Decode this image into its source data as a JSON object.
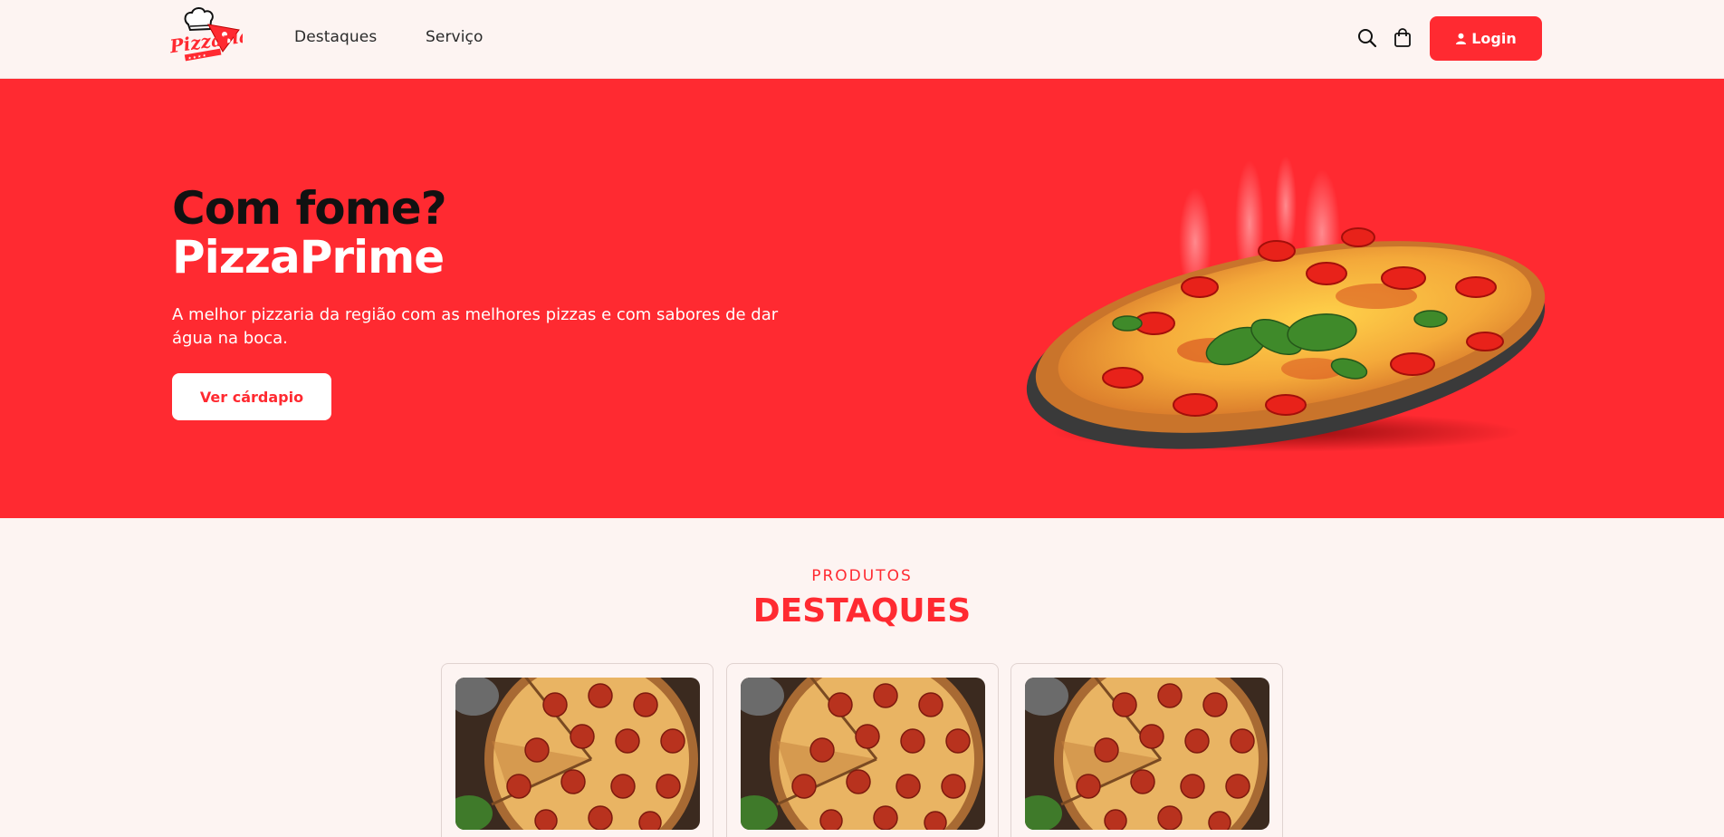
{
  "navbar": {
    "logo_alt": "Pizzaria logo",
    "links": [
      {
        "label": "Destaques"
      },
      {
        "label": "Serviço"
      }
    ],
    "search_icon": "search-icon",
    "cart_icon": "shopping-bag-icon",
    "login_label": "Login",
    "login_icon": "user-icon"
  },
  "hero": {
    "title_line1": "Com fome?",
    "title_line2": "PizzaPrime",
    "description": "A melhor pizzaria da região com as melhores pizzas e com sabores de dar água na boca.",
    "cta_label": "Ver cárdapio",
    "image": "pizza-image"
  },
  "products": {
    "kicker": "PRODUTOS",
    "title": "DESTAQUES",
    "items": [
      {
        "image": "pepperoni-pizza-image"
      },
      {
        "image": "pepperoni-pizza-image"
      },
      {
        "image": "pepperoni-pizza-image"
      }
    ]
  },
  "colors": {
    "brand_red": "#ff2a31",
    "background": "#fdf4f2",
    "text_dark": "#111111",
    "white": "#ffffff"
  }
}
